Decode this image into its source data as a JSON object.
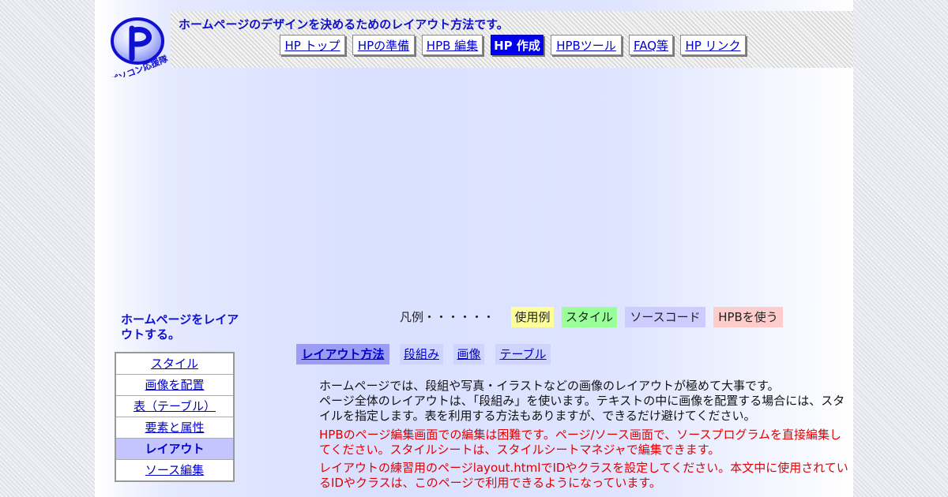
{
  "header": {
    "tagline": "ホームページのデザインを決めるためのレイアウト方法です。",
    "logo_text": "パソコン応援隊"
  },
  "nav": {
    "items": [
      {
        "label": "HP トップ",
        "active": false
      },
      {
        "label": "HPの準備",
        "active": false
      },
      {
        "label": "HPB 編集",
        "active": false
      },
      {
        "label": "HP 作成",
        "active": true
      },
      {
        "label": "HPBツール",
        "active": false
      },
      {
        "label": "FAQ等",
        "active": false
      },
      {
        "label": "HP リンク",
        "active": false
      }
    ]
  },
  "sidebar": {
    "heading": "ホームページをレイアウトする。",
    "items": [
      {
        "label": "スタイル",
        "active": false
      },
      {
        "label": "画像を配置",
        "active": false
      },
      {
        "label": "表（テーブル）",
        "active": false
      },
      {
        "label": "要素と属性",
        "active": false
      },
      {
        "label": "レイアウト",
        "active": true
      },
      {
        "label": "ソース編集",
        "active": false
      }
    ]
  },
  "legend": {
    "label": "凡例・・・・・・",
    "chips": [
      {
        "label": "使用例",
        "color": "#ffff99"
      },
      {
        "label": "スタイル",
        "color": "#99ff99"
      },
      {
        "label": "ソースコード",
        "color": "#ccccff"
      },
      {
        "label": "HPBを使う",
        "color": "#ffcccc"
      }
    ]
  },
  "subnav": {
    "tabs": [
      {
        "label": "レイアウト方法",
        "active": true
      },
      {
        "label": "段組み",
        "active": false
      },
      {
        "label": "画像",
        "active": false
      },
      {
        "label": "テーブル",
        "active": false
      }
    ]
  },
  "content": {
    "intro": "ホームページでは、段組や写真・イラストなどの画像のレイアウトが極めて大事です。\nページ全体のレイアウトは、「段組み」を使います。テキストの中に画像を配置する場合には、スタイルを指定します。表を利用する方法もありますが、できるだけ避けてください。",
    "note1": "HPBのページ編集画面での編集は困難です。ページ/ソース画面で、ソースプログラムを直接編集してください。スタイルシートは、スタイルシートマネジャで編集できます。",
    "note2": "レイアウトの練習用のページlayout.htmlでIDやクラスを設定してください。本文中に使用されているIDやクラスは、このページで利用できるようになっています。"
  },
  "colors": {
    "accent_blue": "#1010cc",
    "active_nav": "#0000ee",
    "warning_red": "#e00000",
    "active_side": "#c4c4ff"
  }
}
